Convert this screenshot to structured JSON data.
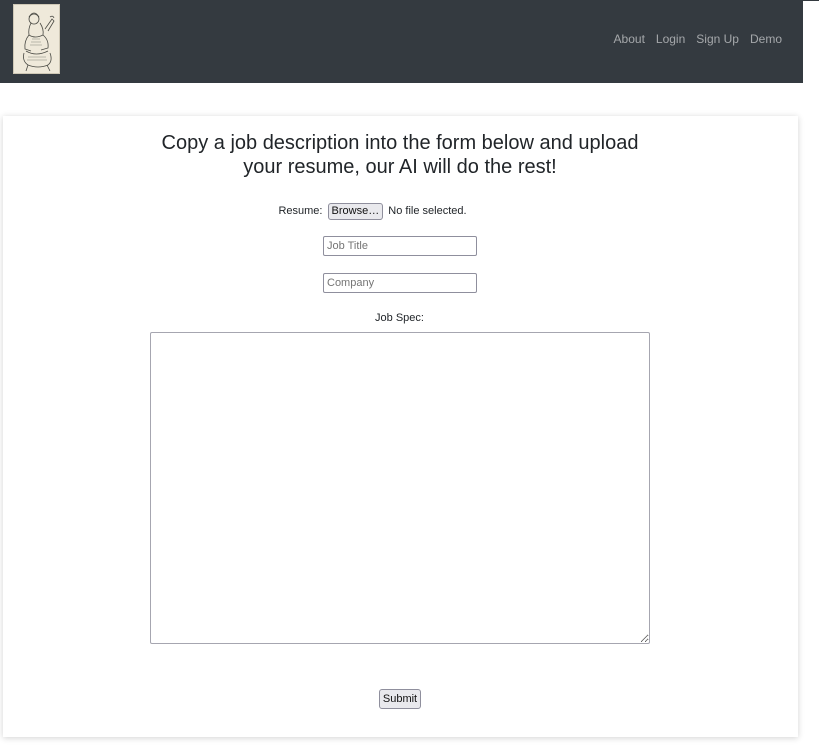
{
  "navbar": {
    "logo_alt": "Logo",
    "links": [
      {
        "label": "About"
      },
      {
        "label": "Login"
      },
      {
        "label": "Sign Up"
      },
      {
        "label": "Demo"
      }
    ],
    "bg_color": "#343a40"
  },
  "main": {
    "heading_line1": "Copy a job description into the form below and upload",
    "heading_line2": "your resume, our AI will do the rest!",
    "resume_label": "Resume:",
    "browse_label": "Browse…",
    "file_status": "No file selected.",
    "job_title_placeholder": "Job Title",
    "company_placeholder": "Company",
    "job_spec_label": "Job Spec:",
    "submit_label": "Submit"
  }
}
